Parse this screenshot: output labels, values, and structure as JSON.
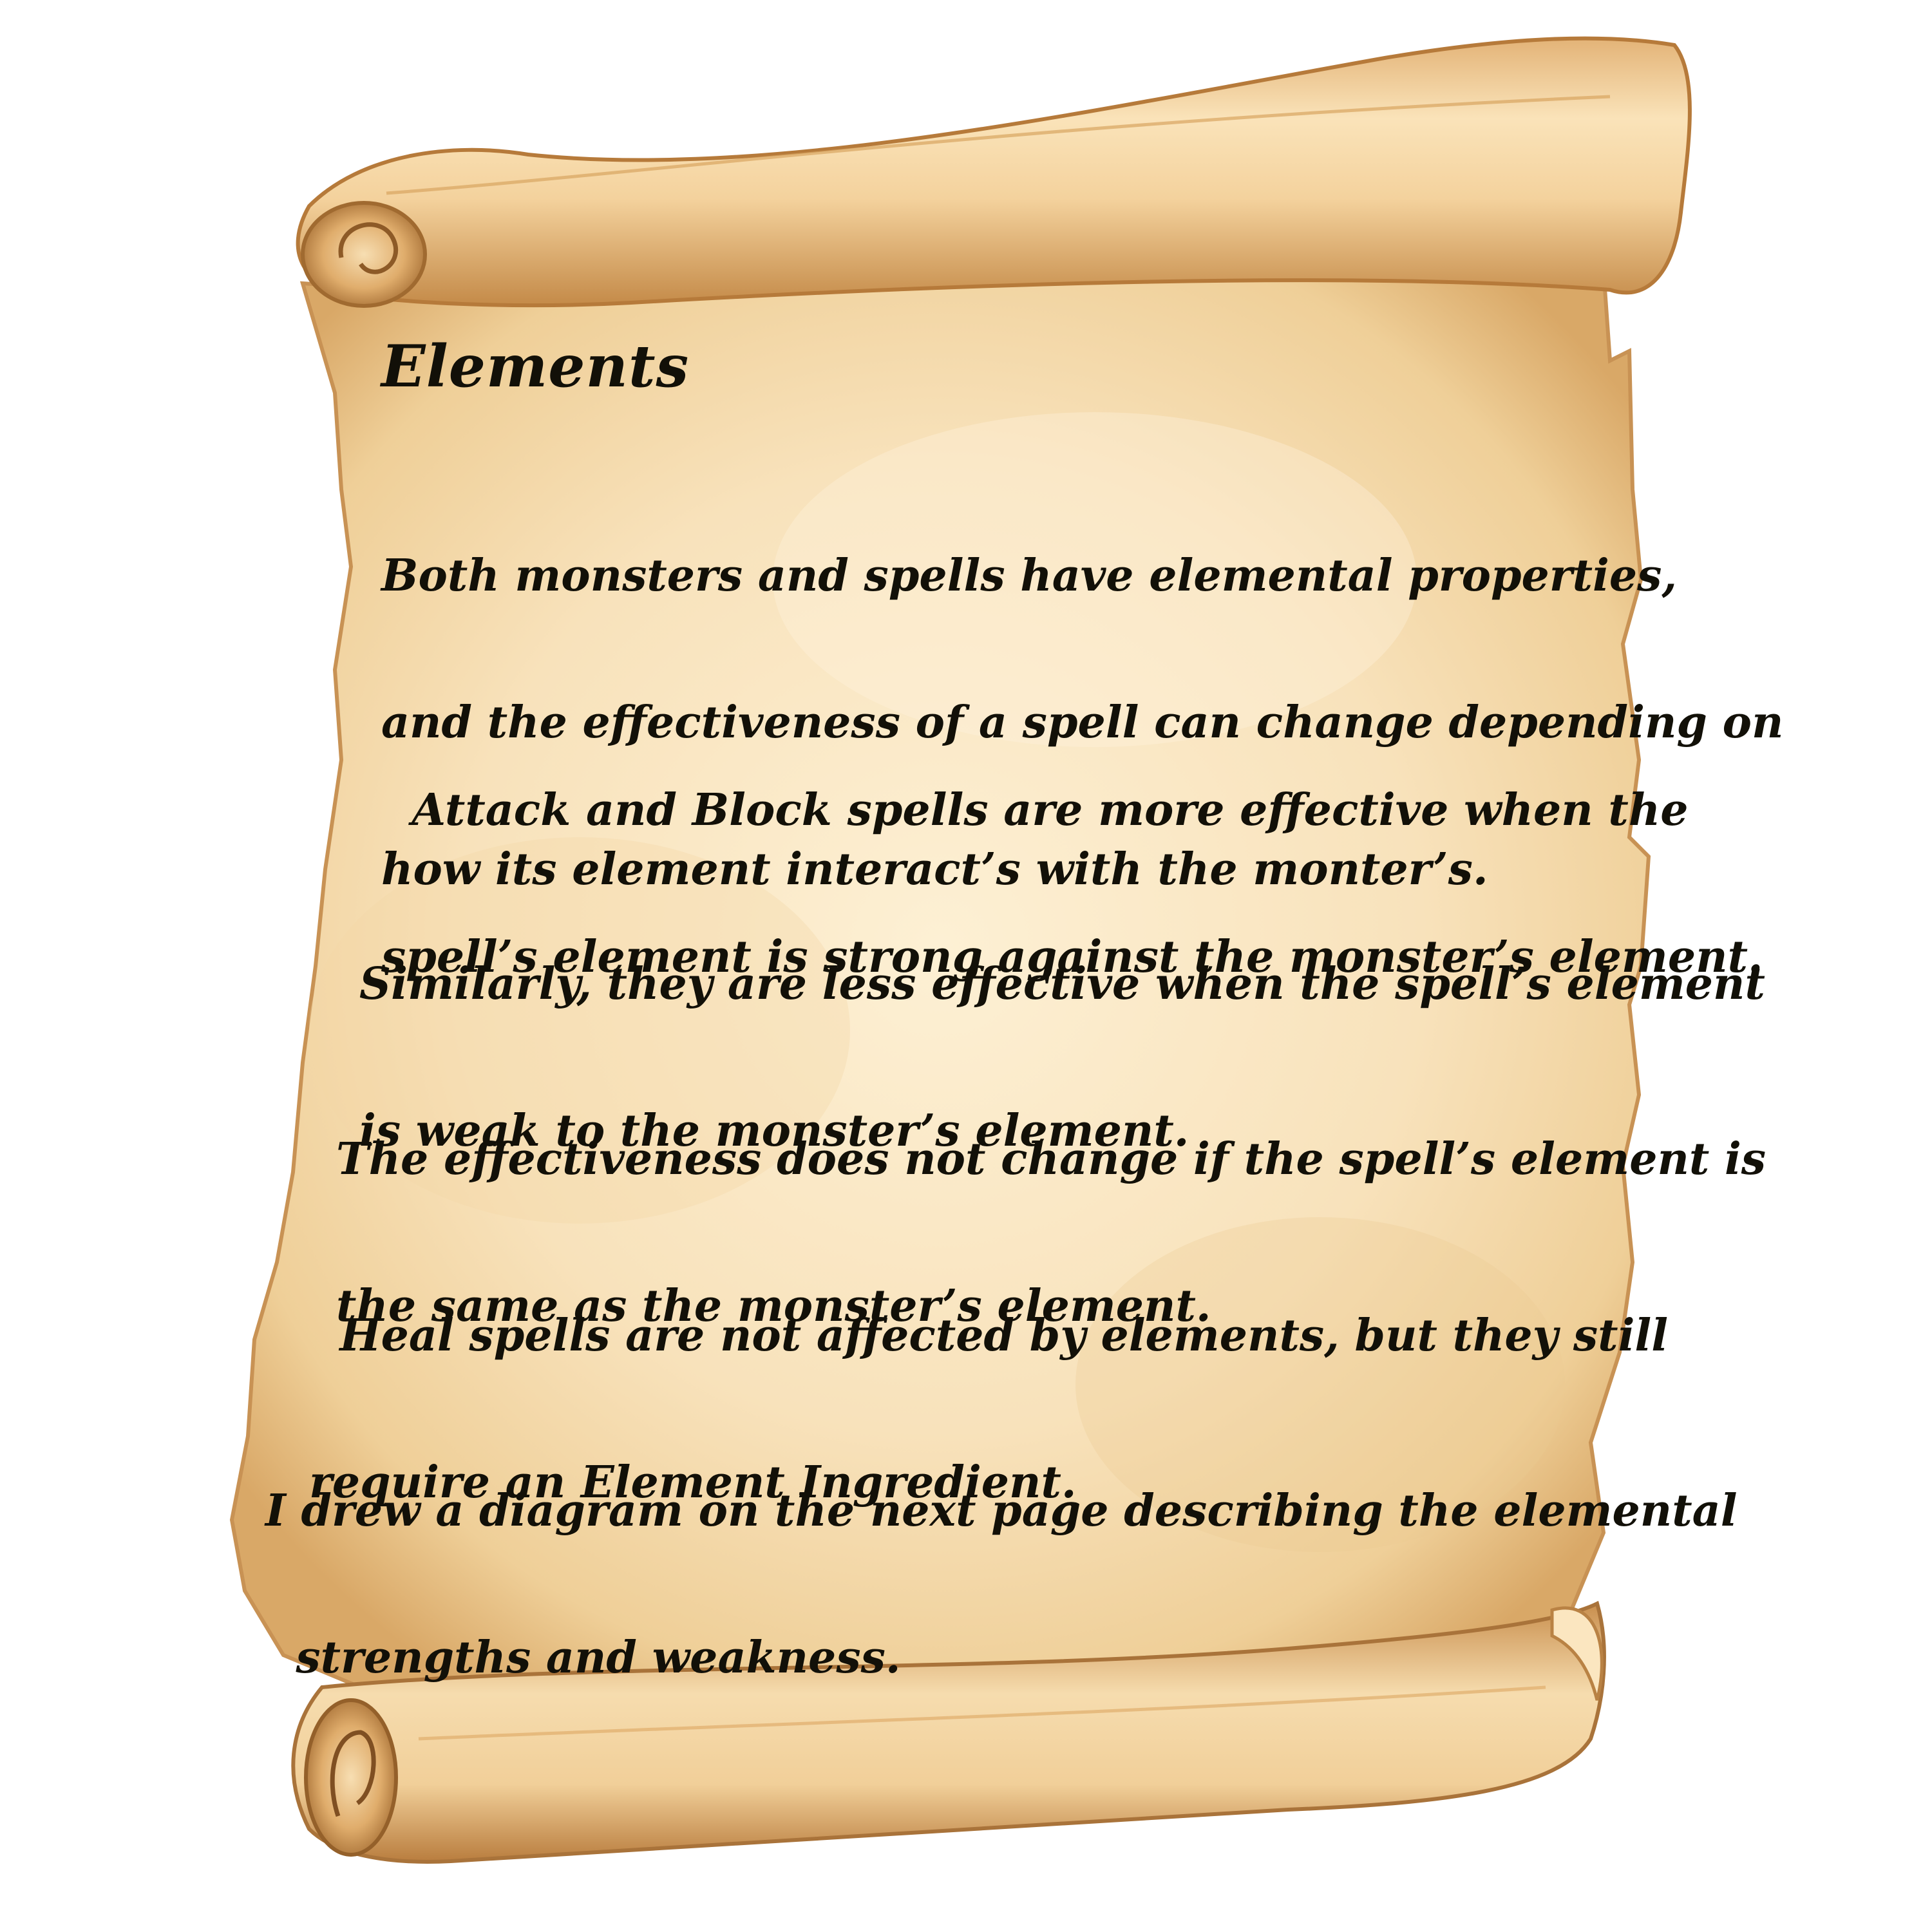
{
  "scroll": {
    "title": "Elements",
    "paragraphs": [
      {
        "lines": [
          "Both monsters and spells have elemental properties,",
          "and the effectiveness of a spell can change depending on",
          "how its element interact’s with the monter’s."
        ]
      },
      {
        "lines": [
          "  Attack and Block spells are more effective when the",
          "spell’s element is strong against the monster’s element."
        ]
      },
      {
        "lines": [
          "Similarly, they are less effective when the spell’s element",
          "is weak to the monster’s element."
        ]
      },
      {
        "lines": [
          "The effectiveness does not change if the spell’s element is",
          "the same as the monster’s element."
        ]
      },
      {
        "lines": [
          "  Heal spells are not affected by elements, but they still",
          "require an Element Ingredient."
        ]
      },
      {
        "lines": [
          "I drew a diagram on the next page describing the elemental",
          "  strengths and weakness."
        ]
      }
    ]
  },
  "colors": {
    "parchment_light": "#fbe8c6",
    "parchment_mid": "#f2d3a0",
    "parchment_edge": "#cf9d5c",
    "roll_shadow": "#a9733a",
    "ink": "#121008",
    "background": "#ffffff"
  }
}
